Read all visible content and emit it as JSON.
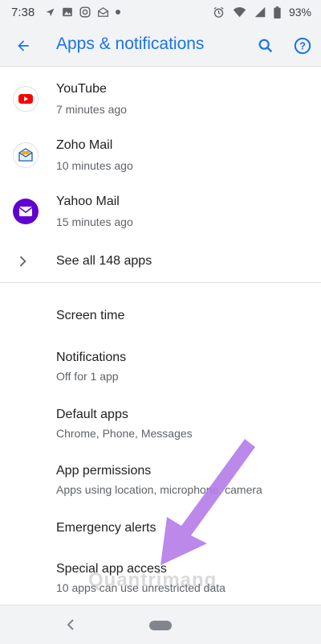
{
  "status_bar": {
    "time": "7:38",
    "battery": "93%",
    "left_icons": [
      "navigation-icon",
      "photo-icon",
      "instagram-icon",
      "mail-icon",
      "dot-icon"
    ],
    "right_icons": [
      "alarm-icon",
      "wifi-icon",
      "signal-icon",
      "battery-icon"
    ]
  },
  "app_bar": {
    "title": "Apps & notifications",
    "accent_color": "#1a73e8"
  },
  "recent_apps": [
    {
      "name": "YouTube",
      "time": "7 minutes ago",
      "icon": "youtube-icon"
    },
    {
      "name": "Zoho Mail",
      "time": "10 minutes ago",
      "icon": "zoho-mail-icon"
    },
    {
      "name": "Yahoo Mail",
      "time": "15 minutes ago",
      "icon": "yahoo-mail-icon"
    }
  ],
  "see_all": {
    "label": "See all 148 apps"
  },
  "settings": [
    {
      "title": "Screen time",
      "subtitle": ""
    },
    {
      "title": "Notifications",
      "subtitle": "Off for 1 app"
    },
    {
      "title": "Default apps",
      "subtitle": "Chrome, Phone, Messages"
    },
    {
      "title": "App permissions",
      "subtitle": "Apps using location, microphone, camera"
    },
    {
      "title": "Emergency alerts",
      "subtitle": ""
    },
    {
      "title": "Special app access",
      "subtitle": "10 apps can use unrestricted data"
    }
  ],
  "watermark": "Quantrimang",
  "annotation_color": "#b57be8"
}
